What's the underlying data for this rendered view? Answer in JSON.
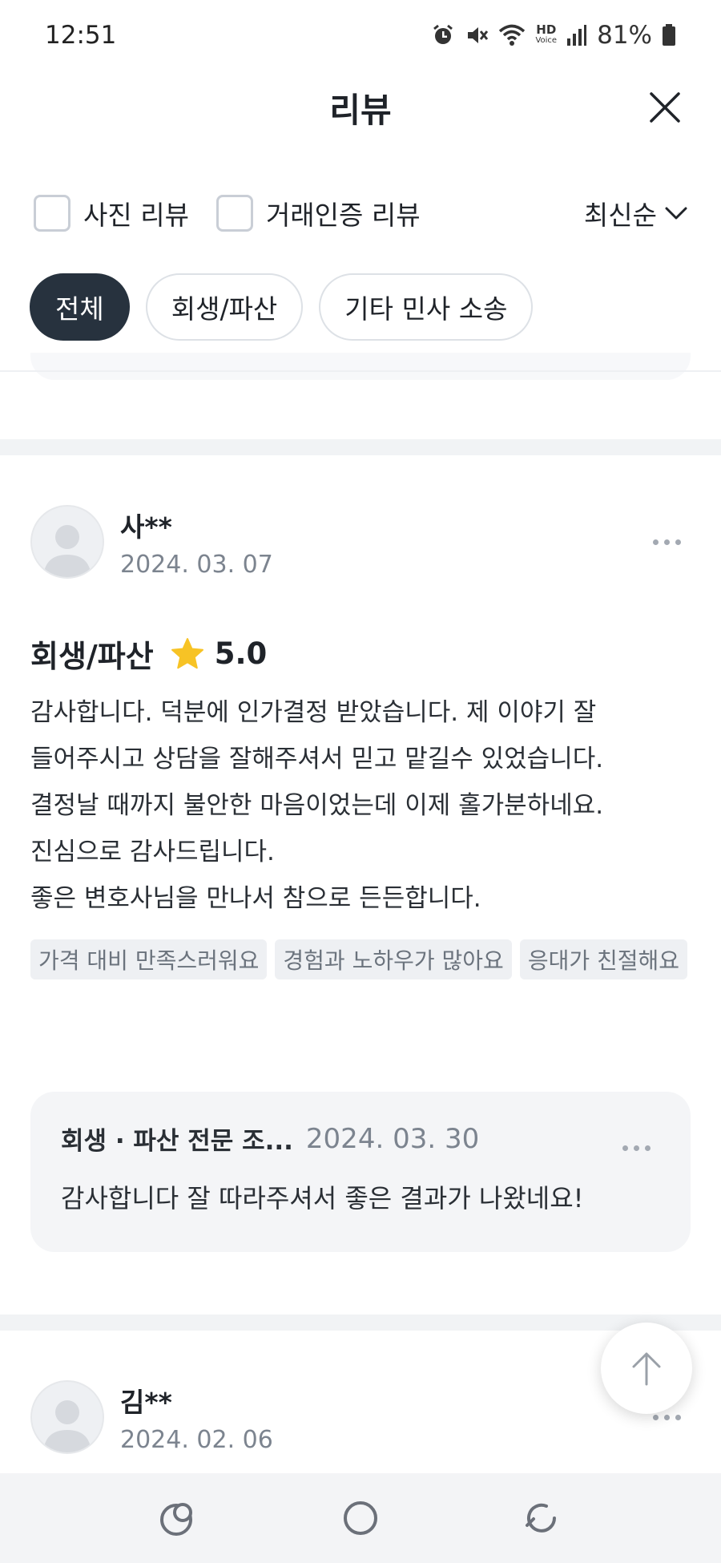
{
  "status_bar": {
    "time": "12:51",
    "battery": "81%",
    "icons": [
      "alarm-icon",
      "mute-icon",
      "wifi-icon",
      "hd-voice-icon",
      "signal-icon",
      "battery-icon"
    ],
    "hd_label": "HD",
    "voice_label": "Voice"
  },
  "header": {
    "title": "리뷰",
    "close_icon": "close-icon"
  },
  "filters": {
    "photo_review": "사진 리뷰",
    "verified_review": "거래인증 리뷰",
    "sort": "최신순"
  },
  "categories": [
    {
      "label": "전체",
      "active": true
    },
    {
      "label": "회생/파산",
      "active": false
    },
    {
      "label": "기타 민사 소송",
      "active": false
    }
  ],
  "reviews": [
    {
      "name": "사**",
      "date": "2024. 03. 07",
      "category": "회생/파산",
      "rating": "5.0",
      "body_lines": [
        "감사합니다. 덕분에 인가결정  받았습니다. 제 이야기 잘",
        "들어주시고 상담을 잘해주셔서 믿고 맡길수 있었습니다.",
        "결정날 때까지 불안한 마음이었는데 이제 홀가분하네요.",
        "진심으로 감사드립니다.",
        "좋은 변호사님을 만나서 참으로 든든합니다."
      ],
      "tags": [
        "가격 대비 만족스러워요",
        "경험과 노하우가 많아요",
        "응대가 친절해요"
      ],
      "reply": {
        "author": "회생 · 파산 전문 조...",
        "date": "2024. 03. 30",
        "text": "감사합니다 잘 따라주셔서 좋은 결과가 나왔네요!"
      }
    },
    {
      "name": "김**",
      "date": "2024. 02. 06"
    }
  ],
  "colors": {
    "active_chip": "#27323e",
    "star": "#f7c325",
    "muted_text": "#7c848f"
  },
  "nav": [
    "recent-apps-icon",
    "home-icon",
    "back-icon"
  ]
}
